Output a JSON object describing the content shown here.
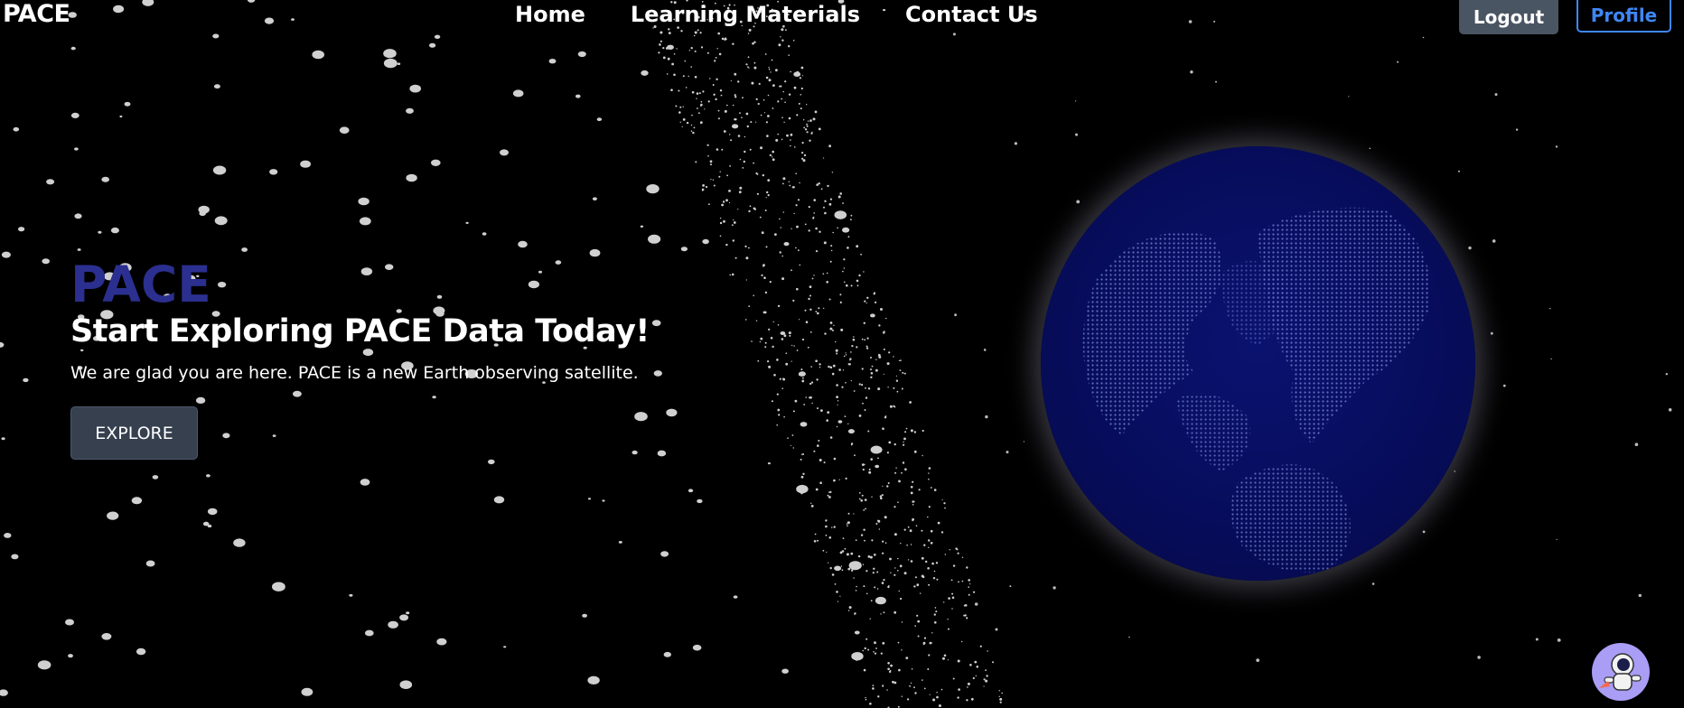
{
  "nav": {
    "brand": "PACE",
    "links": [
      "Home",
      "Learning Materials",
      "Contact Us"
    ],
    "logout_label": "Logout",
    "profile_label": "Profile"
  },
  "hero": {
    "brand": "PACE",
    "title": "Start Exploring PACE Data Today!",
    "subtitle": "We are glad you are here. PACE is a new Earth observing satellite.",
    "button_label": "EXPLORE"
  },
  "icons": {
    "globe": "earth-globe-icon",
    "assistant": "astronaut-icon"
  },
  "colors": {
    "background": "#000000",
    "hero_brand": "#2b2f8f",
    "logout_bg": "#4a5563",
    "profile_accent": "#3f87f5",
    "explore_bg": "#36404f",
    "globe": "#0a1270",
    "assistant_bg": "#a99df5"
  }
}
